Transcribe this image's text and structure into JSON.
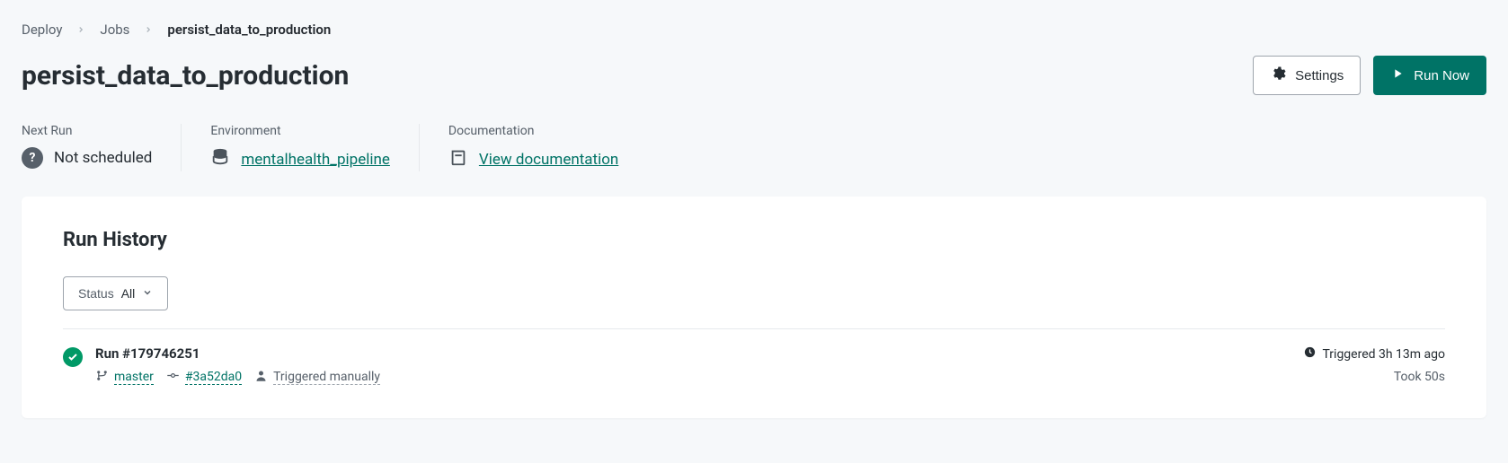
{
  "breadcrumb": {
    "deploy": "Deploy",
    "jobs": "Jobs",
    "current": "persist_data_to_production"
  },
  "page_title": "persist_data_to_production",
  "actions": {
    "settings": "Settings",
    "run_now": "Run Now"
  },
  "info": {
    "next_run_label": "Next Run",
    "next_run_value": "Not scheduled",
    "environment_label": "Environment",
    "environment_value": "mentalhealth_pipeline",
    "documentation_label": "Documentation",
    "documentation_value": "View documentation"
  },
  "history": {
    "title": "Run History",
    "filter_label": "Status",
    "filter_value": "All",
    "runs": [
      {
        "title": "Run #179746251",
        "branch": "master",
        "commit": "#3a52da0",
        "trigger": "Triggered manually",
        "triggered": "Triggered 3h 13m ago",
        "duration": "Took 50s"
      }
    ]
  }
}
